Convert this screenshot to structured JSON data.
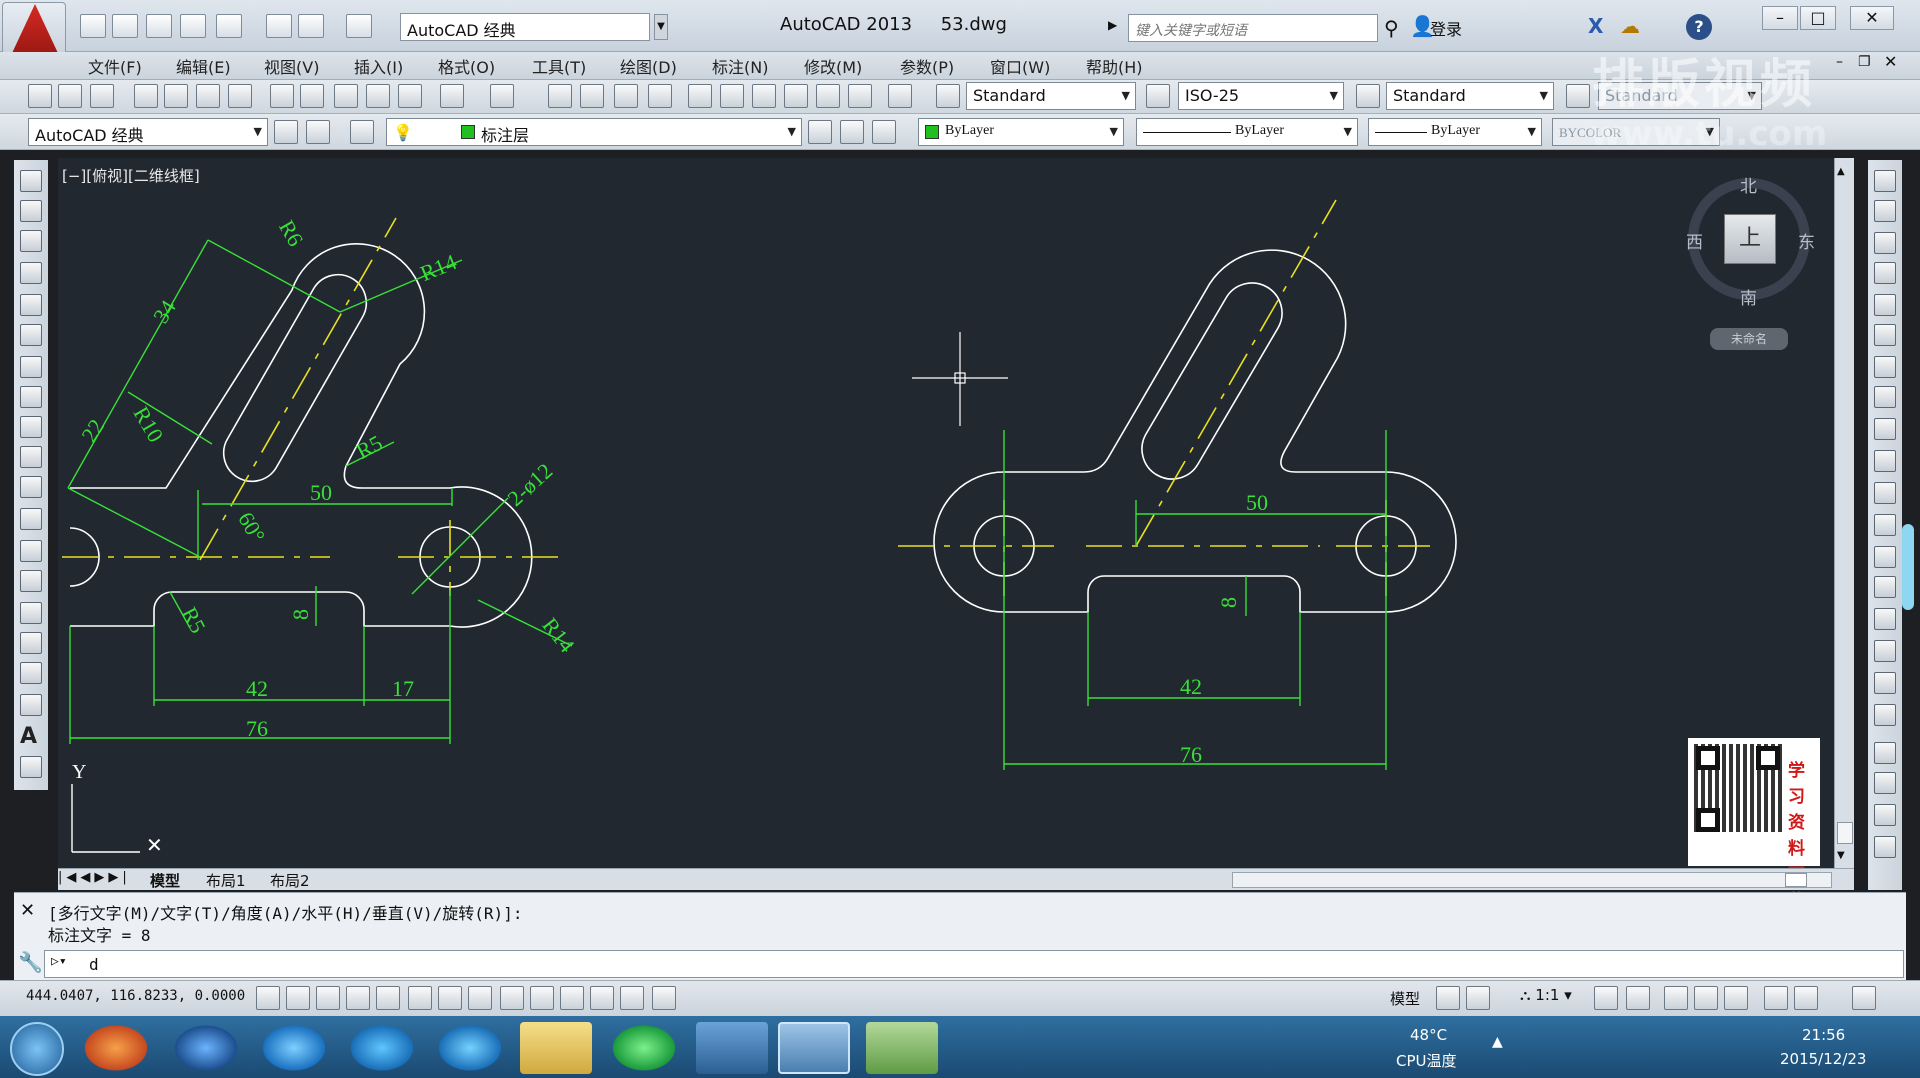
{
  "titlebar": {
    "workspace": "AutoCAD 经典",
    "app_title": "AutoCAD 2013",
    "file_name": "53.dwg",
    "search_placeholder": "键入关键字或短语",
    "login": "登录"
  },
  "menu": [
    "文件(F)",
    "编辑(E)",
    "视图(V)",
    "插入(I)",
    "格式(O)",
    "工具(T)",
    "绘图(D)",
    "标注(N)",
    "修改(M)",
    "参数(P)",
    "窗口(W)",
    "帮助(H)"
  ],
  "toolbar": {
    "text_style": "Standard",
    "dim_style": "ISO-25",
    "table_style": "Standard",
    "multileader_style": "Standard",
    "workspace": "AutoCAD 经典",
    "layer": "标注层",
    "color": "ByLayer",
    "linetype": "ByLayer",
    "lineweight": "ByLayer",
    "plotstyle": "BYCOLOR"
  },
  "viewport": {
    "label": "[−][俯视][二维线框]"
  },
  "compass": {
    "north": "北",
    "south": "南",
    "east": "东",
    "west": "西",
    "top": "上",
    "wcs": "未命名"
  },
  "watermark": {
    "line1": "排版视频",
    "line2": "www.tu.com"
  },
  "qr_label": "学习资料下载",
  "layout_tabs": [
    "模型",
    "布局1",
    "布局2"
  ],
  "command": {
    "history1": "[多行文字(M)/文字(T)/角度(A)/水平(H)/垂直(V)/旋转(R)]:",
    "history2": "标注文字 = 8",
    "input": "d"
  },
  "status": {
    "coords": "444.0407, 116.8233, 0.0000",
    "model": "模型",
    "scale": "1:1"
  },
  "taskbar": {
    "temp": "48°C",
    "temp_label": "CPU温度",
    "time": "21:56",
    "date": "2015/12/23"
  },
  "drawing": {
    "left": {
      "R6": "R6",
      "R14a": "R14",
      "d34": "34",
      "d22": "22",
      "R10": "R10",
      "R5a": "R5",
      "d50": "50",
      "ang": "60°",
      "phi": "2-ø12",
      "d8": "8",
      "R5b": "R5",
      "R14b": "R14",
      "d42": "42",
      "d17": "17",
      "d76": "76"
    },
    "right": {
      "d50": "50",
      "d8": "8",
      "d42": "42",
      "d76": "76"
    }
  }
}
